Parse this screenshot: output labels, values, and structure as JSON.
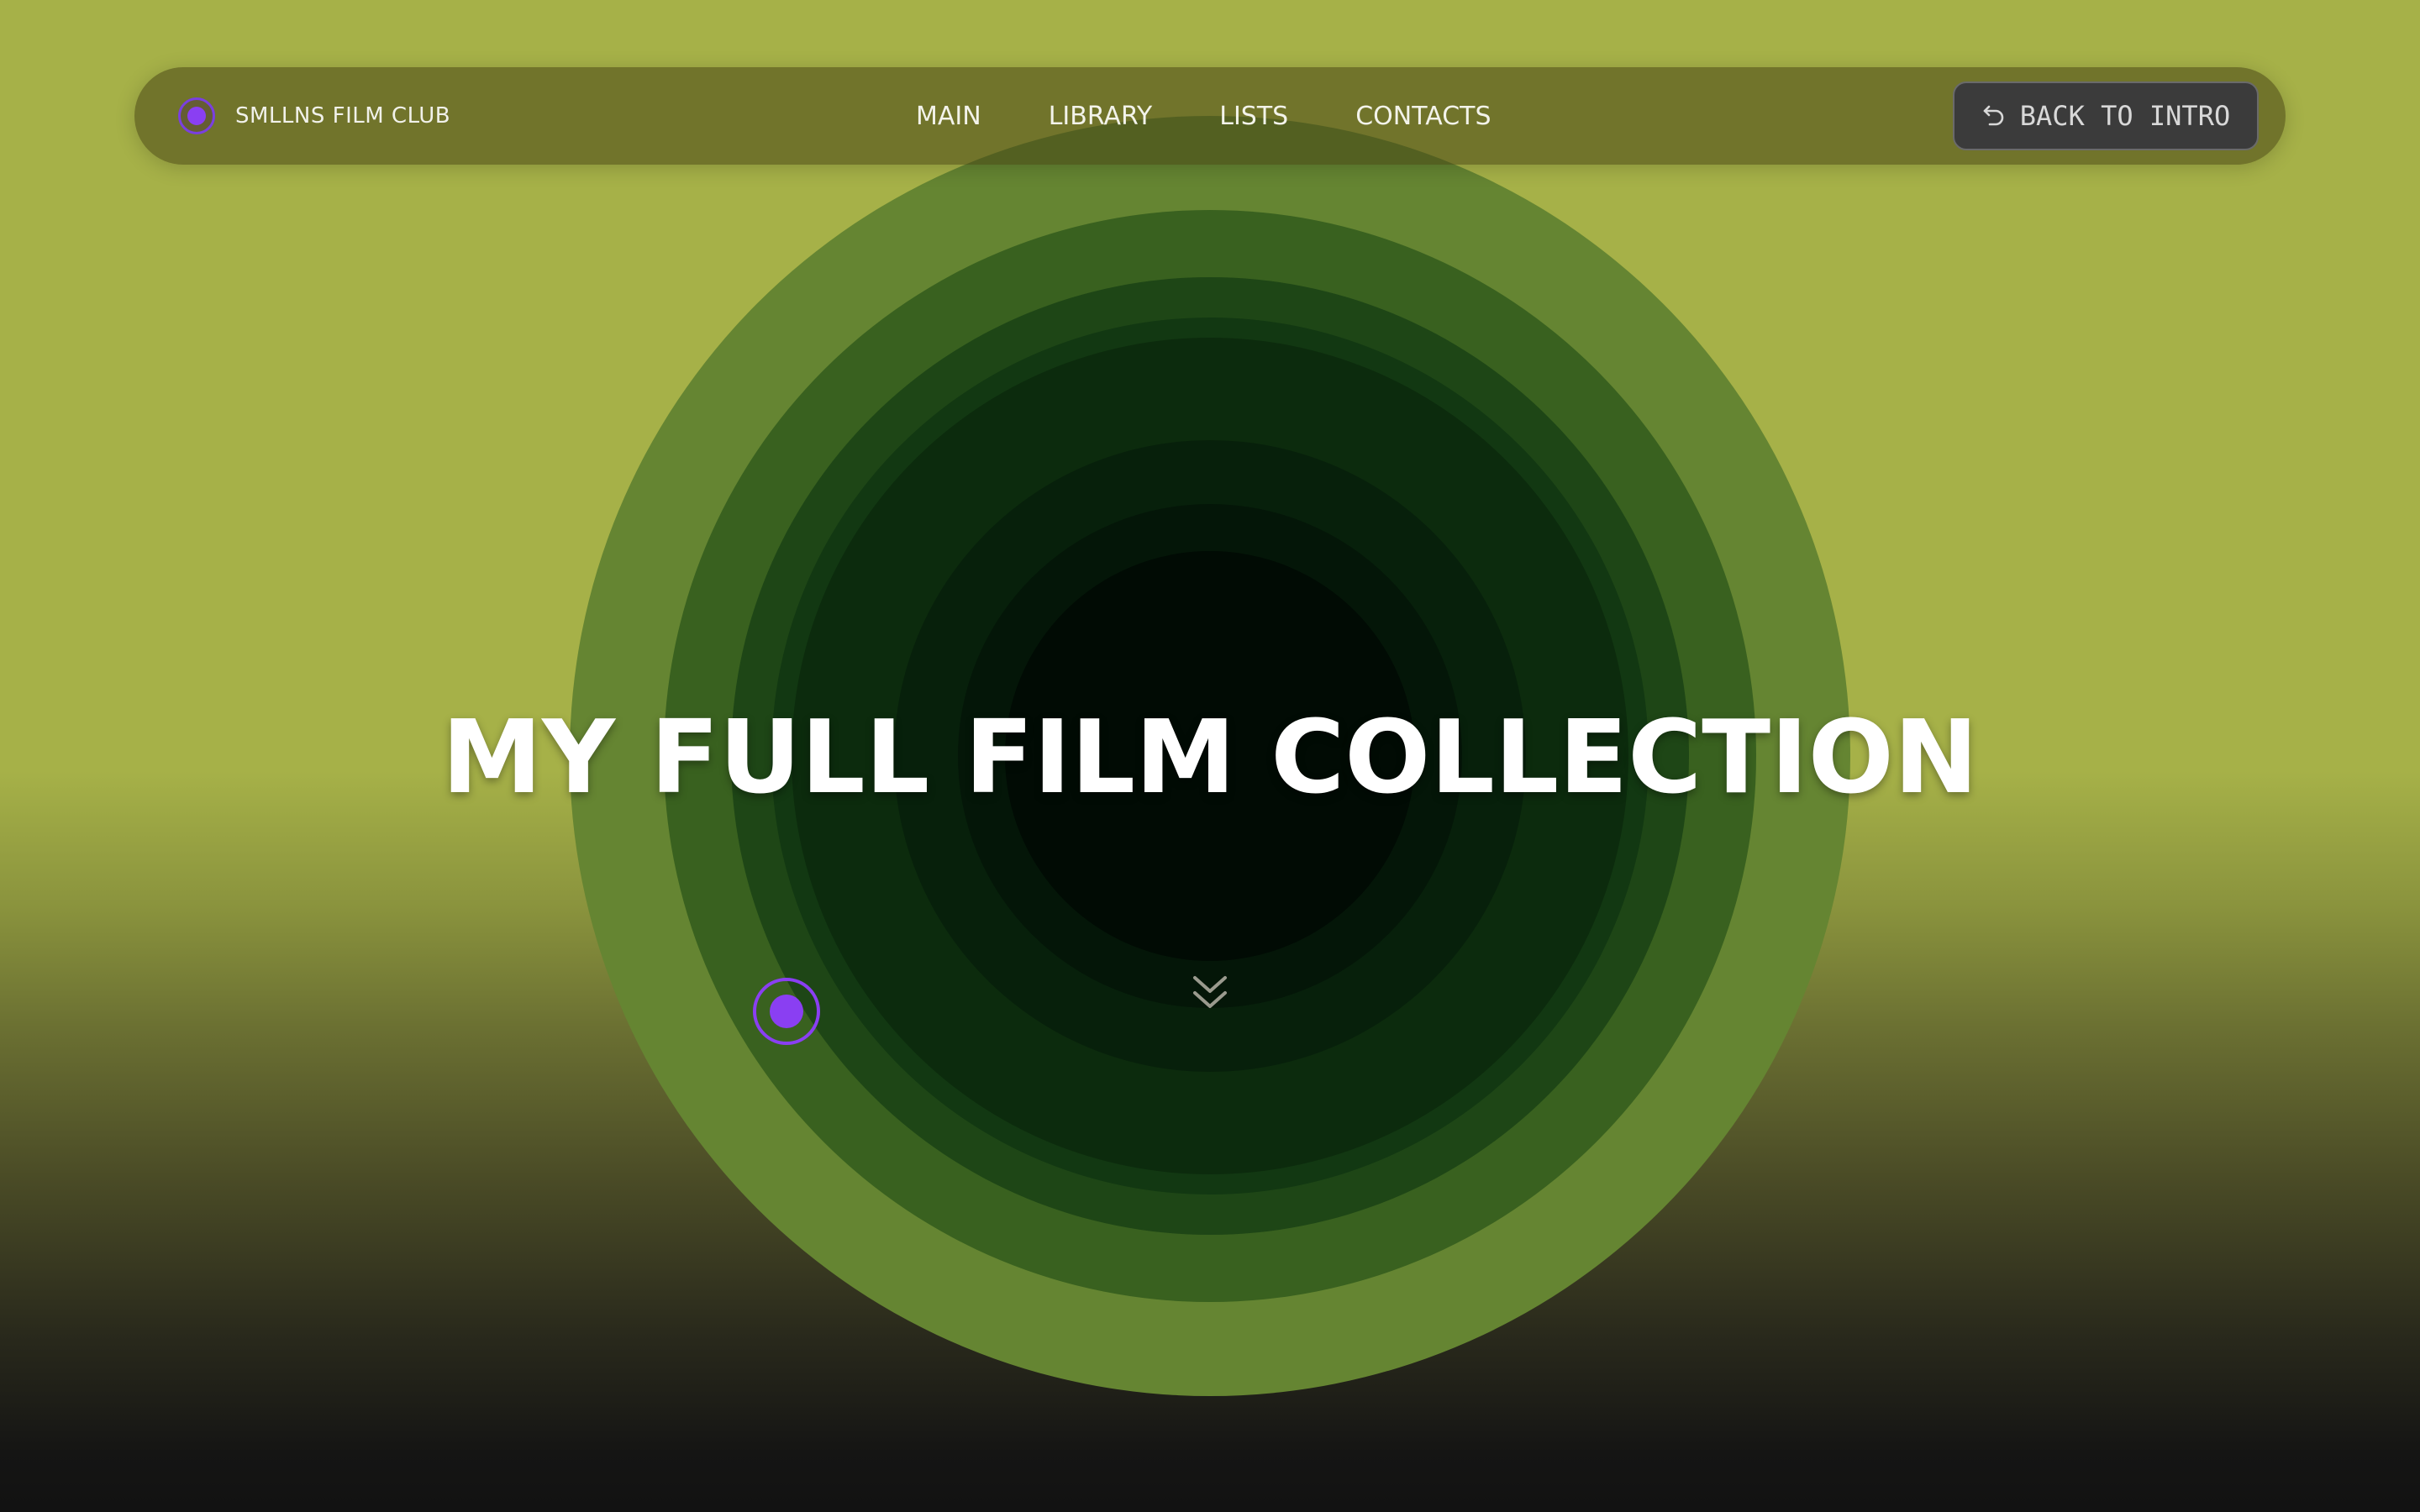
{
  "navbar": {
    "brand_name": "SMLLNS FILM CLUB",
    "links": [
      {
        "label": "MAIN"
      },
      {
        "label": "LIBRARY"
      },
      {
        "label": "LISTS"
      },
      {
        "label": "CONTACTS"
      }
    ],
    "back_button_label": "BACK TO INTRO",
    "back_button_icon": "undo-arrow-icon"
  },
  "hero": {
    "title": "MY FULL FILM COLLECTION",
    "scroll_icon": "double-chevron-down-icon"
  },
  "colors": {
    "background_top": "#a6b148",
    "background_bottom": "#121212",
    "accent": "#8a3ff2",
    "ring_outer": "#658532",
    "ring_center": "#010b04",
    "button_bg": "#3b3b3b"
  }
}
